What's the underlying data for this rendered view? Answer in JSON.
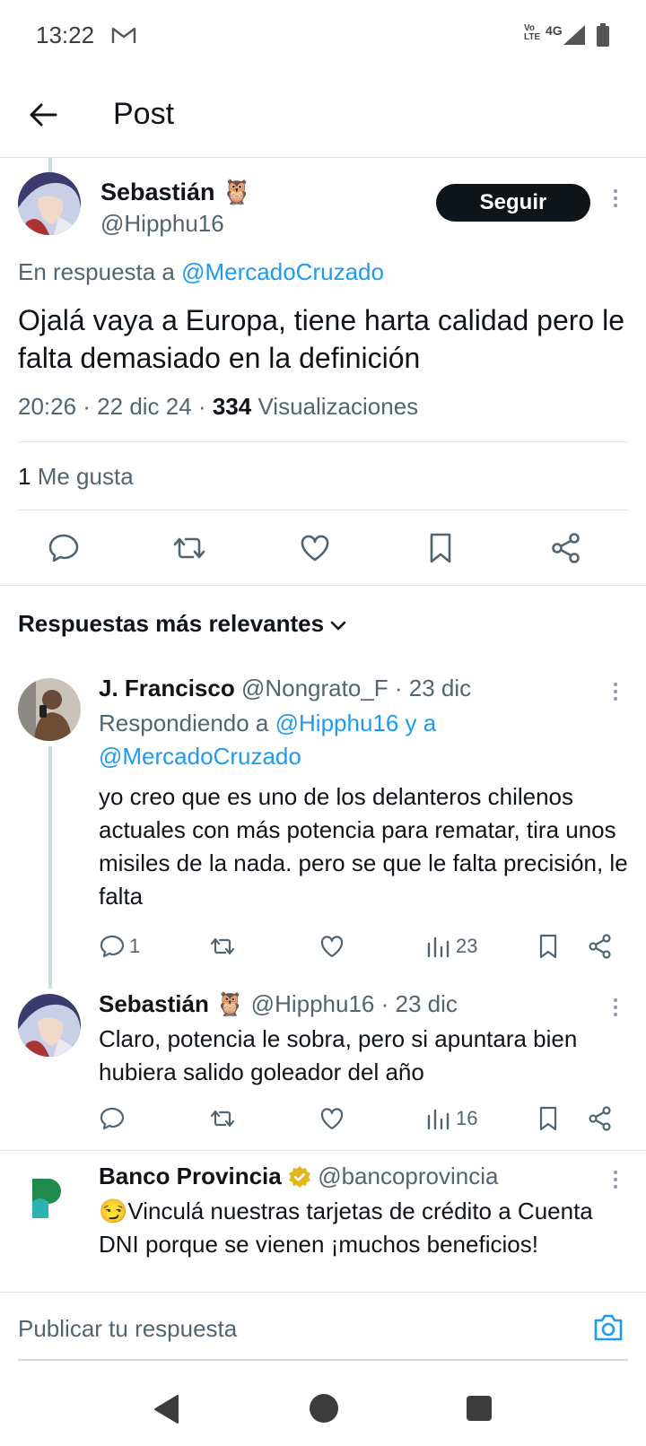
{
  "status_bar": {
    "time": "13:22",
    "volte": "Vo LTE",
    "network": "4G"
  },
  "header": {
    "title": "Post"
  },
  "main_post": {
    "name": "Sebastián",
    "name_emoji": "🦉",
    "handle": "@Hipphu16",
    "follow_label": "Seguir",
    "reply_prefix": "En respuesta a",
    "reply_to": "@MercadoCruzado",
    "text": "Ojalá vaya a Europa, tiene harta calidad pero le falta demasiado en la definición",
    "time_date": "20:26 · 22 dic 24 ·",
    "views_count": "334",
    "views_label": "Visualizaciones",
    "likes_count": "1",
    "likes_label": "Me gusta"
  },
  "sort": {
    "label": "Respuestas más relevantes"
  },
  "replies": [
    {
      "name": "J. Francisco",
      "handle": "@Nongrato_F",
      "date": "· 23 dic",
      "replying_prefix": "Respondiendo a",
      "replying_to": "@Hipphu16 y a @MercadoCruzado",
      "text": "yo creo que es uno de los delanteros chilenos actuales con más potencia para rematar, tira unos misiles de la nada. pero se que le falta precisión, le falta",
      "reply_count": "1",
      "views": "23"
    },
    {
      "name": "Sebastián",
      "name_emoji": "🦉",
      "handle": "@Hipphu16",
      "date": "· 23 dic",
      "text": "Claro, potencia le sobra, pero si apuntara bien hubiera salido goleador del año",
      "views": "16"
    }
  ],
  "ad": {
    "name": "Banco Provincia",
    "handle": "@bancoprovincia",
    "text": "😏Vinculá nuestras tarjetas de crédito a Cuenta DNI porque se vienen ¡muchos beneficios!"
  },
  "compose": {
    "placeholder": "Publicar tu respuesta"
  },
  "colors": {
    "link": "#1d9bf0",
    "text": "#0f1419",
    "muted": "#536471",
    "verified": "#e2b719"
  }
}
